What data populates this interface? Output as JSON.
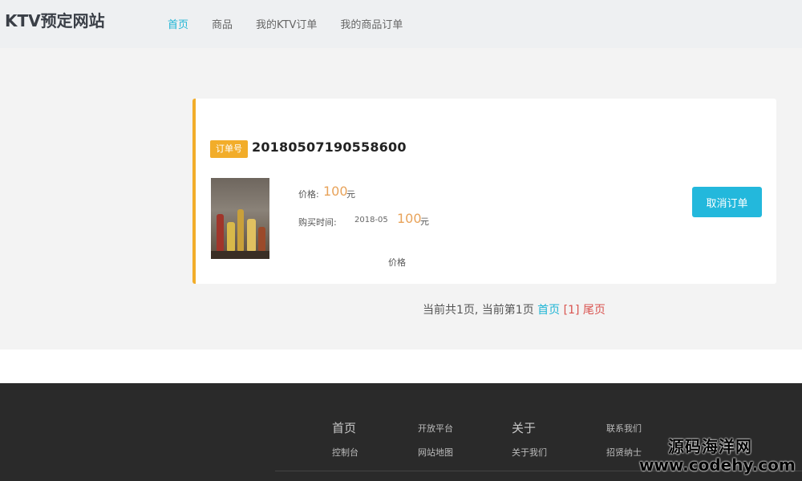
{
  "header": {
    "site_title": "KTV预定网站",
    "nav": [
      {
        "label": "首页",
        "active": true
      },
      {
        "label": "商品",
        "active": false
      },
      {
        "label": "我的KTV订单",
        "active": false
      },
      {
        "label": "我的商品订单",
        "active": false
      }
    ]
  },
  "order": {
    "badge_label": "订单号",
    "order_number": "20180507190558600",
    "product_image": "liquor-bottles-image",
    "price_label": "价格:",
    "price_value": "100",
    "price_unit": "元",
    "purchase_time_label": "购买时间:",
    "purchase_time_value": "2018-05",
    "price_value_2": "100",
    "price_unit_2": "元",
    "price_label_2": "价格",
    "cancel_button": "取消订单"
  },
  "pagination": {
    "summary": "当前共1页, 当前第1页",
    "first_page": "首页",
    "current_page": "[1]",
    "last_page": "尾页"
  },
  "footer": {
    "col1": {
      "title": "首页",
      "link": "控制台"
    },
    "col2": {
      "title": "开放平台",
      "link": "网站地图"
    },
    "col3": {
      "title": "关于",
      "link": "关于我们"
    },
    "col4": {
      "title": "联系我们",
      "link": "招贤纳士"
    }
  },
  "watermark": {
    "name": "源码海洋网",
    "url": "www.codehy.com"
  },
  "colors": {
    "accent_teal": "#1fb5d5",
    "badge_orange": "#f2ad2a",
    "price_orange": "#e8a35a",
    "button_blue": "#23b8dc",
    "link_red": "#d9534f",
    "footer_bg": "#2a2a2a"
  }
}
